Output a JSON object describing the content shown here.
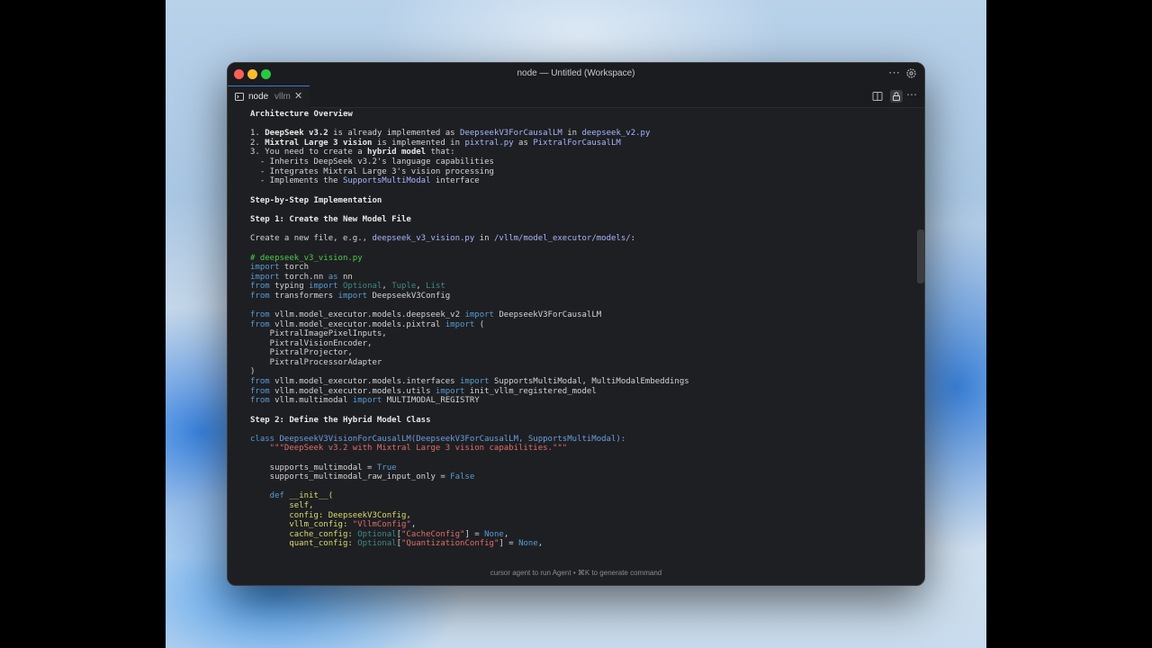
{
  "window": {
    "title": "node — Untitled (Workspace)"
  },
  "tab": {
    "name": "node",
    "subtitle": "vllm",
    "close": "✕"
  },
  "status": {
    "hint": "cursor agent to run Agent • ⌘K to generate command"
  },
  "content": {
    "architecture_heading": "Architecture Overview",
    "item1": {
      "num": "1. ",
      "bold": "DeepSeek v3.2",
      "t1": " is already implemented as ",
      "ref1": "DeepseekV3ForCausalLM",
      "t2": " in ",
      "ref2": "deepseek_v2.py"
    },
    "item2": {
      "num": "2. ",
      "bold": "Mixtral Large 3 vision",
      "t1": " is implemented in ",
      "ref1": "pixtral.py",
      "t2": " as ",
      "ref2": "PixtralForCausalLM"
    },
    "item3": {
      "t1": "3. You need to create a ",
      "bold": "hybrid model",
      "t2": " that:"
    },
    "sub1": "  - Inherits DeepSeek v3.2's language capabilities",
    "sub2": "  - Integrates Mixtral Large 3's vision processing",
    "sub3": {
      "t1": "  - Implements the ",
      "ref": "SupportsMultiModal",
      "t2": " interface"
    },
    "step_heading": "Step-by-Step Implementation",
    "step1_heading": "Step 1: Create the New Model File",
    "create_line": {
      "t1": "Create a new file, e.g., ",
      "ref": "deepseek_v3_vision.py",
      "t2": " in ",
      "ref2": "/vllm/model_executor/models/",
      "t3": ":"
    },
    "code1": {
      "comment": "# deepseek_v3_vision.py",
      "l1": {
        "kw": "import",
        "rest": " torch"
      },
      "l2": {
        "kw": "import",
        "mid": " torch.nn ",
        "kw2": "as",
        "rest": " nn"
      },
      "l3": {
        "kw": "from",
        "mid": " typing ",
        "kw2": "import",
        "t1": " Optional",
        "s1": ", ",
        "t2": "Tuple",
        "s2": ", ",
        "t3": "List"
      },
      "l4": {
        "kw": "from",
        "mid": " transformers ",
        "kw2": "import",
        "rest": " DeepseekV3Config"
      },
      "l5": {
        "kw": "from",
        "mid": " vllm.model_executor.models.deepseek_v2 ",
        "kw2": "import",
        "rest": " DeepseekV3ForCausalLM"
      },
      "l6": {
        "kw": "from",
        "mid": " vllm.model_executor.models.pixtral ",
        "kw2": "import",
        "rest": " ("
      },
      "l7": "    PixtralImagePixelInputs,",
      "l8": "    PixtralVisionEncoder,",
      "l9": "    PixtralProjector,",
      "l10": "    PixtralProcessorAdapter",
      "l11": ")",
      "l12": {
        "kw": "from",
        "mid": " vllm.model_executor.models.interfaces ",
        "kw2": "import",
        "rest": " SupportsMultiModal, MultiModalEmbeddings"
      },
      "l13": {
        "kw": "from",
        "mid": " vllm.model_executor.models.utils ",
        "kw2": "import",
        "rest": " init_vllm_registered_model"
      },
      "l14": {
        "kw": "from",
        "mid": " vllm.multimodal ",
        "kw2": "import",
        "rest": " MULTIMODAL_REGISTRY"
      }
    },
    "step2_heading": "Step 2: Define the Hybrid Model Class",
    "code2": {
      "class_kw": "class",
      "class_sig": " DeepseekV3VisionForCausalLM(DeepseekV3ForCausalLM, SupportsMultiModal):",
      "docstring": "    \"\"\"DeepSeek v3.2 with Mixtral Large 3 vision capabilities.\"\"\"",
      "a1_name": "    supports_multimodal = ",
      "a1_val": "True",
      "a2_name": "    supports_multimodal_raw_input_only = ",
      "a2_val": "False",
      "def_kw": "    def",
      "def_name": " __init__(",
      "p1": "        self,",
      "p2a": "        config: ",
      "p2b": "DeepseekV3Config,",
      "p3a": "        vllm_config: ",
      "p3b": "\"VllmConfig\"",
      "p3c": ",",
      "p4a": "        cache_config: ",
      "p4b": "Optional",
      "p4c": "[",
      "p4d": "\"CacheConfig\"",
      "p4e": "] = ",
      "p4f": "None",
      "p4g": ",",
      "p5a": "        quant_config: ",
      "p5b": "Optional",
      "p5c": "[",
      "p5d": "\"QuantizationConfig\"",
      "p5e": "] = ",
      "p5f": "None",
      "p5g": ","
    }
  }
}
